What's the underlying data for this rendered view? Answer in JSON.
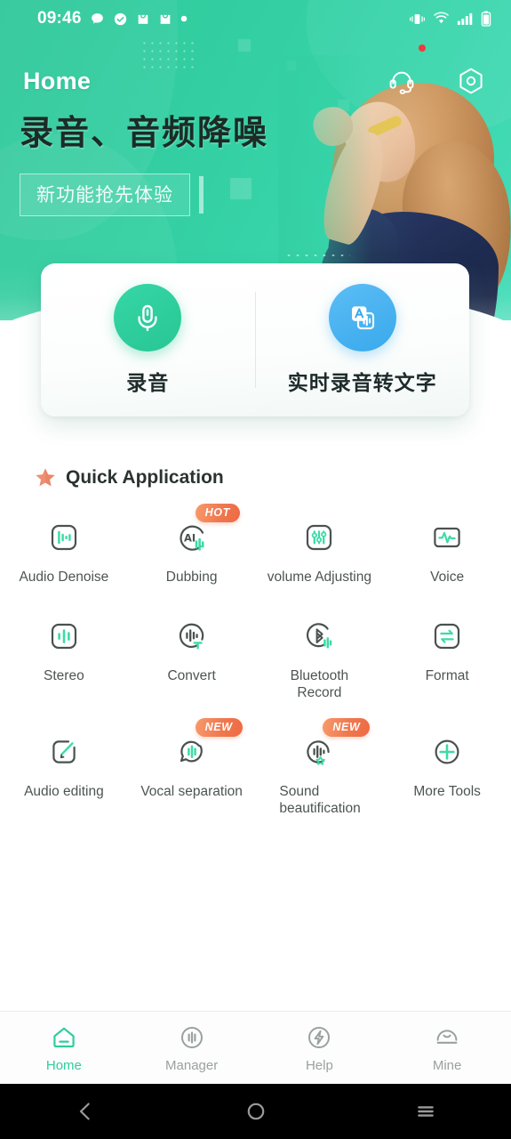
{
  "statusbar": {
    "time": "09:46",
    "left_icons": [
      "message-bubble-icon",
      "check-circle-icon",
      "shopping-bag-icon",
      "shopping-bag-icon",
      "dot-icon"
    ],
    "right_icons": [
      "vibrate-icon",
      "wifi-icon",
      "signal-icon",
      "battery-icon"
    ]
  },
  "appbar": {
    "title": "Home",
    "headset_icon": "headset-icon",
    "settings_icon": "settings-hexagon-icon",
    "has_notification_dot": true
  },
  "banner": {
    "title": "录音、音频降噪",
    "subtitle": "新功能抢先体验"
  },
  "maincard": {
    "items": [
      {
        "label": "录音",
        "icon": "microphone-icon",
        "color": "#28c694"
      },
      {
        "label": "实时录音转文字",
        "icon": "speech-to-text-icon",
        "color": "#39a9ec"
      }
    ]
  },
  "quick": {
    "title": "Quick Application",
    "star_icon": "star-icon",
    "star_color": "#ee8f72",
    "accent_color": "#3ddba8",
    "outline_color": "#4a5250",
    "tiles": [
      {
        "label": "Audio Denoise",
        "icon": "waveform-square-icon",
        "badge": null
      },
      {
        "label": "Dubbing",
        "icon": "ai-dubbing-icon",
        "badge": "HOT"
      },
      {
        "label": "volume Adjusting",
        "icon": "sliders-square-icon",
        "badge": null
      },
      {
        "label": "Voice",
        "icon": "pulse-square-icon",
        "badge": null
      },
      {
        "label": "Stereo",
        "icon": "stereo-bars-square-icon",
        "badge": null
      },
      {
        "label": "Convert",
        "icon": "convert-text-circle-icon",
        "badge": null
      },
      {
        "label": "Bluetooth Record",
        "icon": "bluetooth-circle-icon",
        "badge": null
      },
      {
        "label": "Format",
        "icon": "swap-arrows-square-icon",
        "badge": null
      },
      {
        "label": "Audio editing",
        "icon": "edit-pencil-square-icon",
        "badge": null
      },
      {
        "label": "Vocal separation",
        "icon": "vocal-separation-icon",
        "badge": "NEW"
      },
      {
        "label": "Sound beautification",
        "icon": "sound-beautify-icon",
        "badge": "NEW"
      },
      {
        "label": "More Tools",
        "icon": "plus-circle-icon",
        "badge": null
      }
    ]
  },
  "bottomnav": {
    "active_color": "#2fcd9e",
    "inactive_color": "#9aa1a0",
    "items": [
      {
        "label": "Home",
        "icon": "home-icon",
        "active": true
      },
      {
        "label": "Manager",
        "icon": "manager-icon",
        "active": false
      },
      {
        "label": "Help",
        "icon": "help-bolt-icon",
        "active": false
      },
      {
        "label": "Mine",
        "icon": "profile-icon",
        "active": false
      }
    ]
  },
  "sysnav": {
    "items": [
      {
        "icon": "android-back-icon"
      },
      {
        "icon": "android-home-icon"
      },
      {
        "icon": "android-recents-icon"
      }
    ]
  }
}
